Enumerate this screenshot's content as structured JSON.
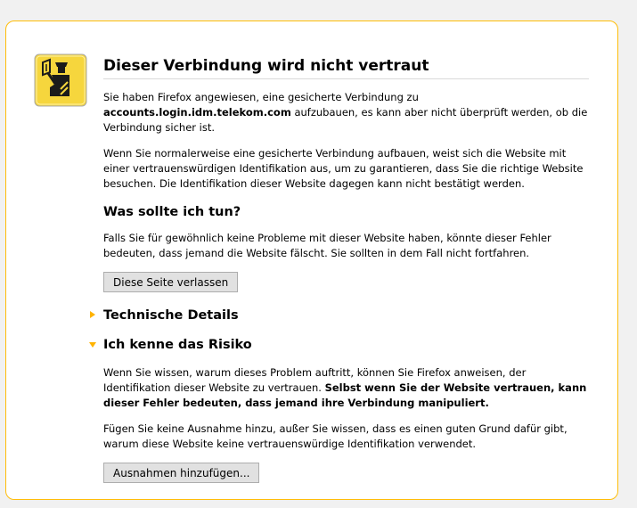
{
  "icon": "security-warning-officer-icon",
  "colors": {
    "accent": "#ffbd09",
    "arrow": "#ffb300",
    "icon_bg": "#f6d63d"
  },
  "title": "Dieser Verbindung wird nicht vertraut",
  "intro": {
    "text_before": "Sie haben Firefox angewiesen, eine gesicherte Verbindung zu ",
    "host": "accounts.login.idm.telekom.com",
    "text_after": " aufzubauen, es kann aber nicht überprüft werden, ob die Verbindung sicher ist."
  },
  "explanation": "Wenn Sie normalerweise eine gesicherte Verbindung aufbauen, weist sich die Website mit einer vertrauenswürdigen Identifikation aus, um zu garantieren, dass Sie die richtige Website besuchen. Die Identifikation dieser Website dagegen kann nicht bestätigt werden.",
  "what_to_do": {
    "heading": "Was sollte ich tun?",
    "text": "Falls Sie für gewöhnlich keine Probleme mit dieser Website haben, könnte dieser Fehler bedeuten, dass jemand die Website fälscht. Sie sollten in dem Fall nicht fortfahren.",
    "button_label": "Diese Seite verlassen"
  },
  "technical_details": {
    "heading": "Technische Details",
    "expanded": false
  },
  "risk": {
    "heading": "Ich kenne das Risiko",
    "expanded": true,
    "text1_plain": "Wenn Sie wissen, warum dieses Problem auftritt, können Sie Firefox anweisen, der Identifikation dieser Website zu vertrauen. ",
    "text1_bold": "Selbst wenn Sie der Website vertrauen, kann dieser Fehler bedeuten, dass jemand ihre Verbindung manipuliert.",
    "text2": "Fügen Sie keine Ausnahme hinzu, außer Sie wissen, dass es einen guten Grund dafür gibt, warum diese Website keine vertrauenswürdige Identifikation verwendet.",
    "button_label": "Ausnahmen hinzufügen..."
  }
}
